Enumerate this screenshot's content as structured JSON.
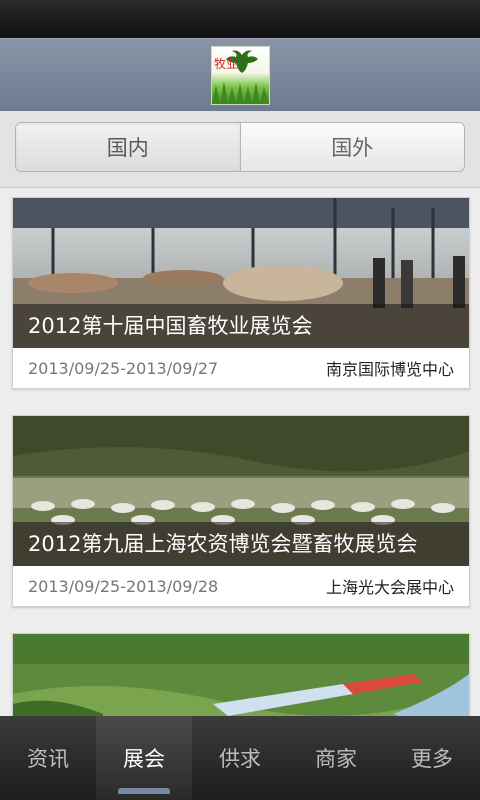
{
  "header": {
    "logo_text": "牧业",
    "logo_icon": "cattle-icon"
  },
  "tabs": [
    {
      "label": "国内",
      "active": true
    },
    {
      "label": "国外",
      "active": false
    }
  ],
  "cards": [
    {
      "title": "2012第十届中国畜牧业展览会",
      "date": "2013/09/25-2013/09/27",
      "venue": "南京国际博览中心"
    },
    {
      "title": "2012第九届上海农资博览会暨畜牧展览会",
      "date": "2013/09/25-2013/09/28",
      "venue": "上海光大会展中心"
    },
    {
      "title": "",
      "date": "",
      "venue": ""
    }
  ],
  "bottom_nav": [
    {
      "label": "资讯",
      "active": false
    },
    {
      "label": "展会",
      "active": true
    },
    {
      "label": "供求",
      "active": false
    },
    {
      "label": "商家",
      "active": false
    },
    {
      "label": "更多",
      "active": false
    }
  ],
  "colors": {
    "header": "#7c879b",
    "nav_bg": "#262626",
    "accent": "#7a8aa3"
  }
}
